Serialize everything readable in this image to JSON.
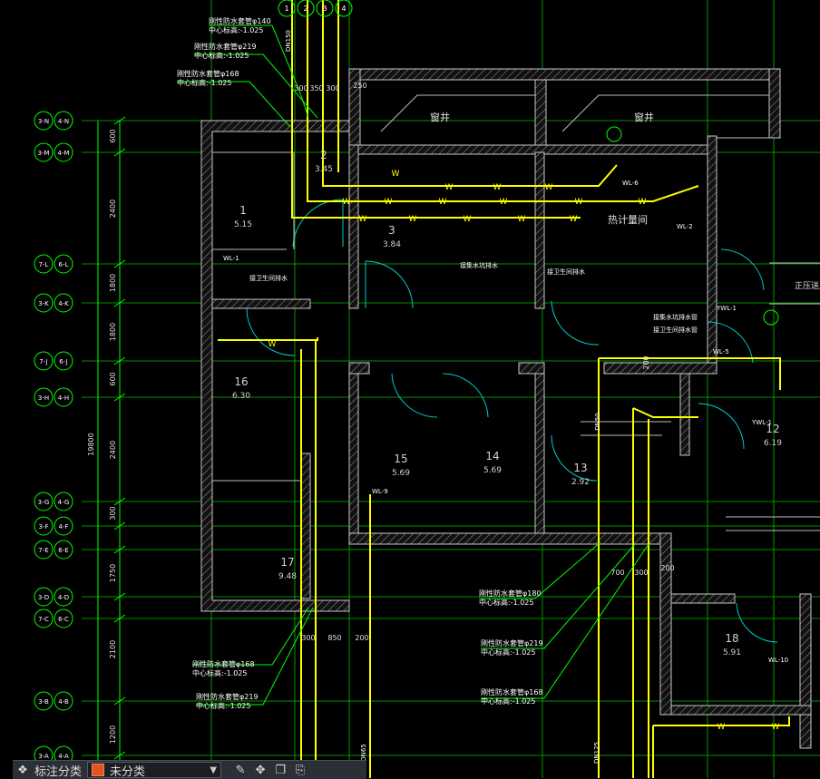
{
  "colors": {
    "background": "#000000",
    "wall": "#c8c8c8",
    "axis": "#00e000",
    "pipe": "#ffff00",
    "leader": "#00ff00",
    "door": "#00d0d0",
    "text": "#e0e0e0"
  },
  "top_axis_labels": [
    "1",
    "2",
    "3",
    "4"
  ],
  "rooms": [
    {
      "name": "1",
      "area": "5.15"
    },
    {
      "name": "2",
      "area": "3.45"
    },
    {
      "name": "3",
      "area": "3.84"
    },
    {
      "name": "16",
      "area": "6.30"
    },
    {
      "name": "15",
      "area": "5.69"
    },
    {
      "name": "14",
      "area": "5.69"
    },
    {
      "name": "13",
      "area": "2.92"
    },
    {
      "name": "12",
      "area": "6.19"
    },
    {
      "name": "17",
      "area": "9.48"
    },
    {
      "name": "18",
      "area": "5.91"
    }
  ],
  "room_labels": {
    "well_left": "窗井",
    "well_right": "窗井",
    "meter": "热计量间",
    "pressure": "正压送风"
  },
  "axis_bubbles": [
    {
      "a": "3-N",
      "b": "4-N"
    },
    {
      "a": "3-M",
      "b": "4-M"
    },
    {
      "a": "7-L",
      "b": "6-L"
    },
    {
      "a": "3-K",
      "b": "4-K"
    },
    {
      "a": "7-J",
      "b": "6-J"
    },
    {
      "a": "3-H",
      "b": "4-H"
    },
    {
      "a": "3-G",
      "b": "4-G"
    },
    {
      "a": "3-F",
      "b": "4-F"
    },
    {
      "a": "7-E",
      "b": "6-E"
    },
    {
      "a": "3-D",
      "b": "4-D"
    },
    {
      "a": "7-C",
      "b": "6-C"
    },
    {
      "a": "3-B",
      "b": "4-B"
    },
    {
      "a": "3-A",
      "b": "4-A"
    }
  ],
  "vertical_dims": [
    "600",
    "2400",
    "1800",
    "1800",
    "600",
    "2400",
    "300",
    "1750",
    "2100",
    "1200"
  ],
  "vertical_total": "19800",
  "sleeve_notes": [
    {
      "line1": "刚性防水套管φ140",
      "line2": "中心标高:-1.025"
    },
    {
      "line1": "刚性防水套管φ219",
      "line2": "中心标高:-1.025"
    },
    {
      "line1": "刚性防水套管φ168",
      "line2": "中心标高:-1.025"
    },
    {
      "line1": "刚性防水套管φ168",
      "line2": "中心标高:-1.025"
    },
    {
      "line1": "刚性防水套管φ219",
      "line2": "中心标高:-1.025"
    },
    {
      "line1": "刚性防水套管φ180",
      "line2": "中心标高:-1.025"
    },
    {
      "line1": "刚性防水套管φ219",
      "line2": "中心标高:-1.025"
    },
    {
      "line1": "刚性防水套管φ168",
      "line2": "中心标高:-1.025"
    }
  ],
  "dims": {
    "top": [
      "300",
      "350",
      "300",
      "250"
    ],
    "bottom_left": [
      "300",
      "850",
      "200"
    ],
    "bottom_right": [
      "700",
      "300",
      "200"
    ],
    "right_mid": "200"
  },
  "pipe_tags": [
    "WL-6",
    "WL-2",
    "WL-1",
    "WL-9",
    "WL-10",
    "YWL-1",
    "YWL-1",
    "WL-5"
  ],
  "pipe_notes": [
    "接集水坑排水",
    "接卫生间排水",
    "接卫生间排水",
    "接卫生间排水管",
    "接集水坑排水管"
  ],
  "pipe_sizes": [
    "DN150",
    "DN50",
    "DN65",
    "DN125"
  ],
  "toolbar": {
    "label": "标注分类",
    "selected": "未分类"
  }
}
